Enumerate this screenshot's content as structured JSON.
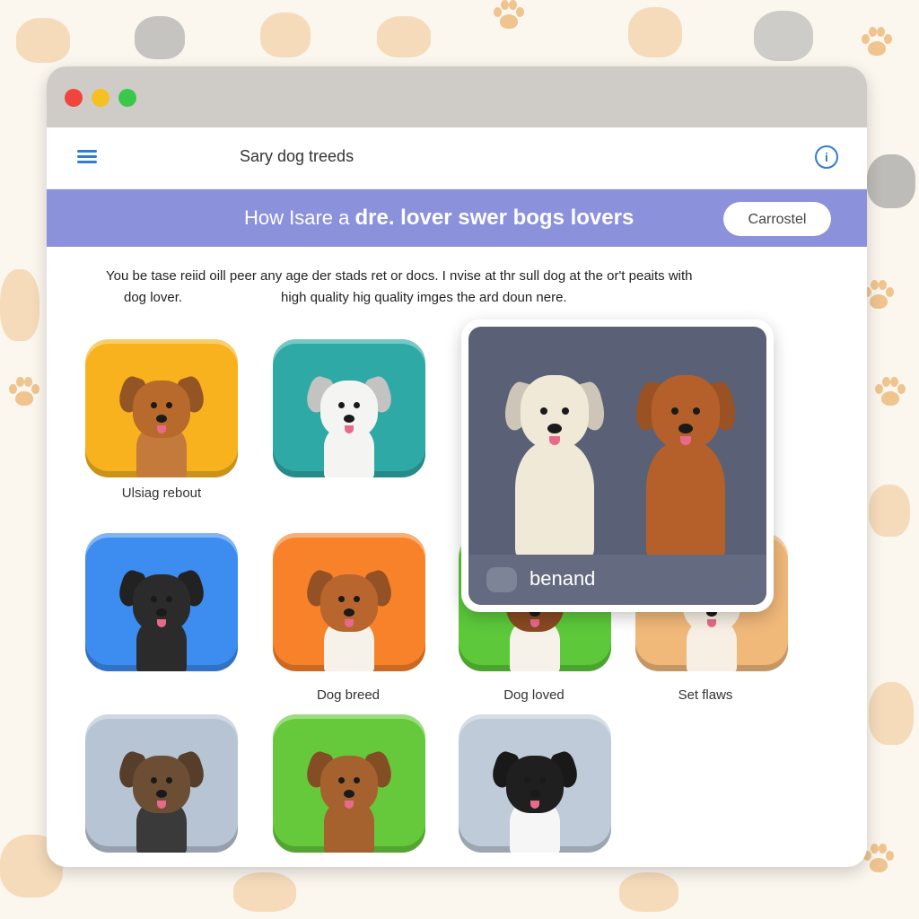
{
  "window": {
    "app_title": "Sary dog treeds",
    "info_glyph": "i"
  },
  "banner": {
    "text_plain": "How Isare a ",
    "text_bold": "dre. lover swer bogs lovers",
    "button_label": "Carrostel"
  },
  "intro": {
    "line1": "You be tase reiid oill peer any age der stads ret or docs. I nvise at thr sull dog at the or't peaits with",
    "line2a": "dog lover.",
    "line2b": "high quality hig quality imges the ard doun nere."
  },
  "tiles": [
    {
      "label": "Ulsiag rebout",
      "bg": "#f7b21e",
      "coat": "#b86a2c",
      "body": "#c47a3a"
    },
    {
      "label": "",
      "bg": "#2fa9a6",
      "coat": "#f4f4f2",
      "body": "#f4f4f2"
    },
    {
      "label": "",
      "bg": "#3d8cf0",
      "coat": "#2b2b2b",
      "body": "#2b2b2b"
    },
    {
      "label": "Dog breed",
      "bg": "#f7822a",
      "coat": "#b8652e",
      "body": "#f6f2ea"
    },
    {
      "label": "Dog loved",
      "bg": "#5cc83a",
      "coat": "#8a4a22",
      "body": "#f6f2ea"
    },
    {
      "label": "Set flaws",
      "bg": "#f0b879",
      "coat": "#f7efe3",
      "body": "#f7efe3"
    },
    {
      "label": "",
      "bg": "#b7c4d4",
      "coat": "#6b4e34",
      "body": "#3a3a3a"
    },
    {
      "label": "",
      "bg": "#66c93c",
      "coat": "#a5622e",
      "body": "#a5622e"
    },
    {
      "label": "",
      "bg": "#bfcbd8",
      "coat": "#1f1f1f",
      "body": "#f6f6f6"
    }
  ],
  "popup": {
    "label": "benand",
    "dog1_coat": "#f1e9d8",
    "dog2_coat": "#b5602a"
  }
}
